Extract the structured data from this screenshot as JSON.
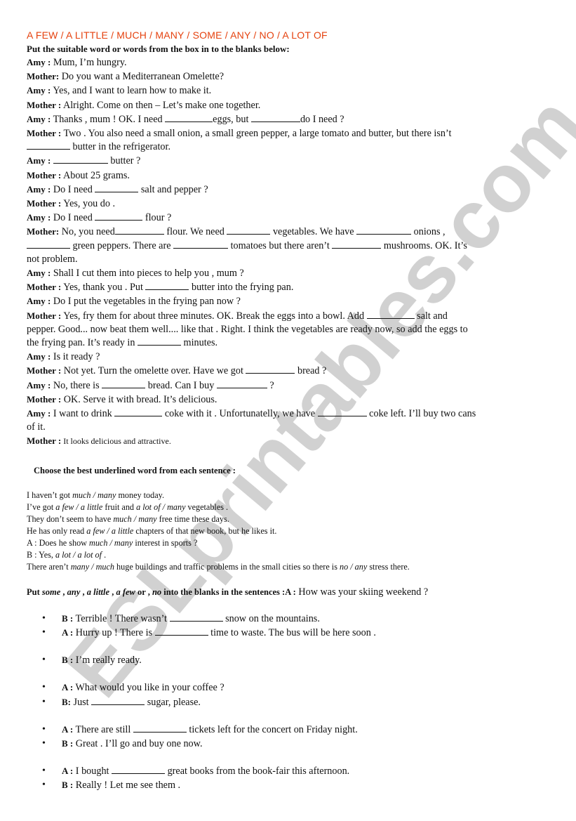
{
  "title": "A FEW / A LITTLE / MUCH / MANY / SOME / ANY / NO / A LOT OF",
  "section1": {
    "instruction": "Put the suitable word or words from the box in to the blanks below:",
    "lines": [
      {
        "speaker": "Amy :",
        "parts": [
          " Mum, I’m hungry."
        ]
      },
      {
        "speaker": "Mother:",
        "parts": [
          " Do you want a Mediterranean Omelette?"
        ]
      },
      {
        "speaker": "Amy :",
        "parts": [
          " Yes, and I want to learn how to make it."
        ]
      },
      {
        "speaker": "Mother :",
        "parts": [
          " Alright. Come on then – Let’s make one together."
        ]
      },
      {
        "speaker": "Amy :",
        "parts": [
          " Thanks , mum ! OK. I need ",
          "eggs, but ",
          "do I need ?"
        ]
      },
      {
        "speaker": "Mother :",
        "parts": [
          " Two .  You also need a small onion, a small green pepper, a large tomato and butter, but there isn’t "
        ]
      },
      {
        "speaker": "",
        "parts": [
          "",
          " butter in the refrigerator."
        ]
      },
      {
        "speaker": "Amy :",
        "parts": [
          " ",
          " butter ?"
        ]
      },
      {
        "speaker": "Mother :",
        "parts": [
          " About 25 grams."
        ]
      },
      {
        "speaker": "Amy :",
        "parts": [
          " Do I need ",
          " salt and pepper ?"
        ]
      },
      {
        "speaker": "Mother :",
        "parts": [
          " Yes, you do ."
        ]
      },
      {
        "speaker": "Amy :",
        "parts": [
          " Do I need ",
          " flour ?"
        ]
      },
      {
        "speaker": "Mother:",
        "parts": [
          " No, you need",
          " flour. We need ",
          " vegetables. We have ",
          " onions ,"
        ]
      },
      {
        "speaker": "",
        "parts": [
          "",
          " green peppers. There are ",
          " tomatoes but there aren’t ",
          " mushrooms. OK. It’s"
        ]
      },
      {
        "speaker": "",
        "parts": [
          "not problem."
        ]
      },
      {
        "speaker": "Amy :",
        "parts": [
          " Shall I cut them into pieces to help you , mum ?"
        ]
      },
      {
        "speaker": "Mother :",
        "parts": [
          " Yes, thank you . Put ",
          " butter into the frying pan."
        ]
      },
      {
        "speaker": "Amy :",
        "parts": [
          " Do I put the vegetables in the frying pan now ?"
        ]
      },
      {
        "speaker": "Mother :",
        "parts": [
          " Yes, fry them for about three minutes. OK. Break the eggs into a bowl. Add ",
          " salt and"
        ]
      },
      {
        "speaker": "",
        "parts": [
          "pepper. Good... now beat them well.... like that . Right. I think the vegetables are ready now, so add the eggs to"
        ]
      },
      {
        "speaker": "",
        "parts": [
          "the frying pan. It’s ready in ",
          " minutes."
        ]
      },
      {
        "speaker": "Amy :",
        "parts": [
          " Is it ready ?"
        ]
      },
      {
        "speaker": "Mother :",
        "parts": [
          " Not yet. Turn the omelette over. Have we got ",
          " bread ?"
        ]
      },
      {
        "speaker": "Amy :",
        "parts": [
          " No, there is ",
          " bread. Can I buy ",
          " ?"
        ]
      },
      {
        "speaker": "Mother :",
        "parts": [
          " OK. Serve it with bread. It’s delicious."
        ]
      },
      {
        "speaker": "Amy :",
        "parts": [
          " I want to drink ",
          " coke with it . Unfortunatelly, we have ",
          " coke left. I’ll buy two cans"
        ]
      },
      {
        "speaker": "",
        "parts": [
          "of it."
        ]
      },
      {
        "speaker": "Mother :",
        "parts": [
          " It looks delicious and attractive."
        ],
        "small": true
      }
    ]
  },
  "section2": {
    "instruction": "Choose the best underlined word from each sentence :",
    "sentences": [
      [
        {
          "t": "I haven’t got "
        },
        {
          "i": "much / many"
        },
        {
          "t": " money today."
        }
      ],
      [
        {
          "t": "I’ve got "
        },
        {
          "i": "a few / a little"
        },
        {
          "t": " fruit and "
        },
        {
          "i": "a lot of / many"
        },
        {
          "t": " vegetables ."
        }
      ],
      [
        {
          "t": "They don’t seem to have "
        },
        {
          "i": "much / many"
        },
        {
          "t": " free time these days."
        }
      ],
      [
        {
          "t": "He has only read "
        },
        {
          "i": "a few / a little"
        },
        {
          "t": " chapters of that new book, but he likes it."
        }
      ],
      [
        {
          "t": "A : Does he show "
        },
        {
          "i": "much / many"
        },
        {
          "t": " interest in sports ?"
        }
      ],
      [
        {
          "t": "B : Yes, "
        },
        {
          "i": "a lot / a lot of"
        },
        {
          "t": " ."
        }
      ],
      [
        {
          "t": "There aren’t "
        },
        {
          "i": "many / much"
        },
        {
          "t": " huge buildings and traffic problems in the small cities so there is "
        },
        {
          "i": "no / any"
        },
        {
          "t": " stress there."
        }
      ]
    ]
  },
  "section3": {
    "instruction_parts": [
      {
        "b": "Put "
      },
      {
        "bi": "some"
      },
      {
        "b": " , "
      },
      {
        "bi": "any"
      },
      {
        "b": " , "
      },
      {
        "bi": "a little"
      },
      {
        "b": " , "
      },
      {
        "bi": "a few"
      },
      {
        "b": " or , "
      },
      {
        "bi": "no"
      },
      {
        "b": " into the blanks in the sentences :"
      },
      {
        "b": "A :"
      }
    ],
    "instruction_tail": " How was your skiing weekend ?",
    "items": [
      {
        "speaker": "B :",
        "parts": [
          " Terrible ! There wasn’t ",
          " snow on the mountains."
        ],
        "gap": false
      },
      {
        "speaker": "A :",
        "parts": [
          " Hurry up ! There is ",
          " time to waste. The bus will be here soon ."
        ],
        "gap": false
      },
      {
        "speaker": "B :",
        "parts": [
          " I’m really ready."
        ],
        "gap": true
      },
      {
        "speaker": "A :",
        "parts": [
          " What would you like in your coffee ?"
        ],
        "gap": true
      },
      {
        "speaker": "B:",
        "parts": [
          " Just ",
          " sugar, please."
        ],
        "gap": false
      },
      {
        "speaker": "A :",
        "parts": [
          " There are still ",
          " tickets left for the concert on Friday night."
        ],
        "gap": true
      },
      {
        "speaker": "B :",
        "parts": [
          " Great . I’ll go and buy one now."
        ],
        "gap": false
      },
      {
        "speaker": "A :",
        "parts": [
          " I bought ",
          " great books from the book-fair this afternoon."
        ],
        "gap": true
      },
      {
        "speaker": "B :",
        "parts": [
          " Really ! Let me see them ."
        ],
        "gap": false
      }
    ]
  },
  "watermark": {
    "text": "ESLprintables.com",
    "color": "#c8c8c8"
  },
  "colors": {
    "title": "#e5420f",
    "text": "#111111"
  }
}
